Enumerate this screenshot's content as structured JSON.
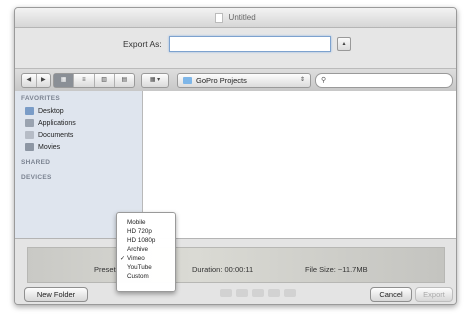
{
  "window": {
    "title": "Untitled"
  },
  "export": {
    "label": "Export As:",
    "value": "",
    "expand_glyph": "▴"
  },
  "toolbar": {
    "nav": [
      "◀",
      "▶"
    ],
    "views": [
      "▦",
      "≡",
      "▥",
      "▤"
    ],
    "arrange": "▦ ▾",
    "location": "GoPro Projects",
    "location_arrows": "⇕",
    "search_icon": "⚲",
    "search_placeholder": ""
  },
  "sidebar": {
    "favorites_header": "FAVORITES",
    "items": [
      {
        "label": "Desktop",
        "icon": "desktop-icon",
        "color": "#7a9cc7"
      },
      {
        "label": "Applications",
        "icon": "applications-icon",
        "color": "#9aa3b0"
      },
      {
        "label": "Documents",
        "icon": "documents-icon",
        "color": "#b6bcc6"
      },
      {
        "label": "Movies",
        "icon": "movies-icon",
        "color": "#8d96a3"
      }
    ],
    "shared_header": "SHARED",
    "devices_header": "DEVICES"
  },
  "preset_menu": {
    "options": [
      "Mobile",
      "HD 720p",
      "HD 1080p",
      "Archive",
      "Vimeo",
      "YouTube",
      "Custom"
    ],
    "selected": "Vimeo",
    "check": "✓"
  },
  "bottom": {
    "preset_label": "Preset",
    "duration": "Duration:  00:00:11",
    "file_size": "File Size:  ~11.7MB",
    "new_folder": "New Folder",
    "cancel": "Cancel",
    "export_button": "Export"
  },
  "colors": {
    "accent": "#7da2ce",
    "sidebar_bg": "#dfe5ee",
    "folder": "#7eb6e8"
  }
}
